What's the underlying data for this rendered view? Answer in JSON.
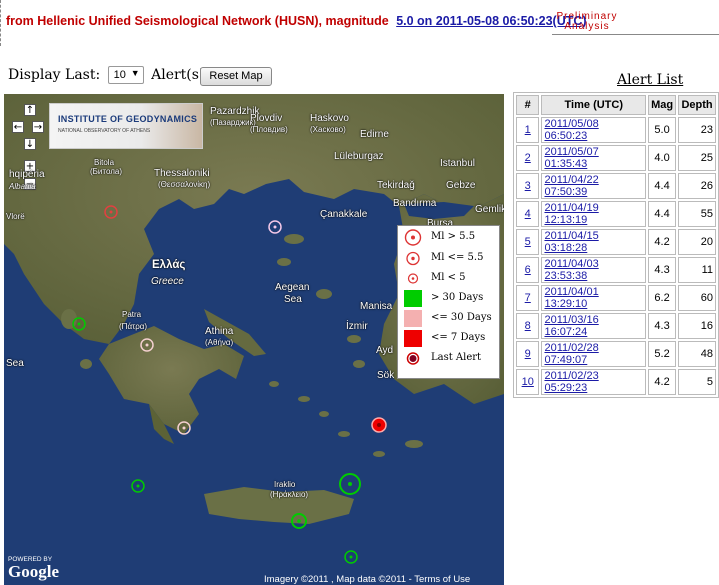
{
  "header": {
    "prefix": "from Hellenic Unified Seismological Network (HUSN), magnitude",
    "link": "5.0 on 2011-05-08 06:50:23(UTC)",
    "prelim_line1": "Preliminary",
    "prelim_line2": "Analysis"
  },
  "controls": {
    "display_last_label": "Display Last:",
    "select_value": "10",
    "alerts_label": "Alert(s)",
    "reset_label": "Reset Map"
  },
  "map": {
    "logo_title": "INSTITUTE OF GEODYNAMICS",
    "logo_sub": "NATIONAL OBSERVATORY OF ATHENS",
    "labels": {
      "shqiperia": "hqipëria",
      "albania": "Albania",
      "bitola": "Bitola",
      "bitola_cyr": "(Битола)",
      "thessaloniki": "Thessaloniki",
      "thessaloniki_gr": "(Θεσσαλονίκη)",
      "vlore": "Vlorë",
      "ellas": "Ελλάς",
      "greece": "Greece",
      "patra": "Patra",
      "patra_gr": "(Πάτρα)",
      "athina": "Athina",
      "athina_gr": "(Αθήνα)",
      "aegean": "Aegean",
      "sea": "Sea",
      "sea_west": "Sea",
      "pazardzhik": "Pazardzhik",
      "pazardzhik_cyr": "(Пазарджик)",
      "plovdiv": "Plovdiv",
      "plovdiv_cyr": "(Пловдив)",
      "haskovo": "Haskovo",
      "haskovo_cyr": "(Хасково)",
      "edirne": "Edirne",
      "luleburgaz": "Lüleburgaz",
      "istanbul": "Istanbul",
      "tekirdag": "Tekirdağ",
      "gebze": "Gebze",
      "bandirma": "Bandırma",
      "gemlik": "Gemlik",
      "canakkale": "Çanakkale",
      "bursa": "Bursa",
      "manisa": "Manisa",
      "izmir": "İzmir",
      "ayd": "Ayd",
      "sok": "Sök",
      "iraklio": "Iraklio",
      "iraklio_gr": "(Ηράκλειο)"
    },
    "powered_by": "POWERED BY",
    "google": "Google",
    "copyright": "Imagery ©2011 , Map data ©2011 - Terms of Use"
  },
  "legend": {
    "items": [
      {
        "label": "Ml > 5.5"
      },
      {
        "label": "Ml <= 5.5"
      },
      {
        "label": "Ml < 5"
      },
      {
        "label": "> 30 Days",
        "color": "#00cc00"
      },
      {
        "label": "<= 30 Days",
        "color": "#f4b0b0"
      },
      {
        "label": "<= 7 Days",
        "color": "#ee0000"
      },
      {
        "label": "Last Alert"
      }
    ]
  },
  "alert_list": {
    "title": "Alert List",
    "columns": [
      "#",
      "Time (UTC)",
      "Mag",
      "Depth"
    ],
    "rows": [
      {
        "n": "1",
        "time": "2011/05/08 06:50:23",
        "mag": "5.0",
        "depth": "23"
      },
      {
        "n": "2",
        "time": "2011/05/07 01:35:43",
        "mag": "4.0",
        "depth": "25"
      },
      {
        "n": "3",
        "time": "2011/04/22 07:50:39",
        "mag": "4.4",
        "depth": "26"
      },
      {
        "n": "4",
        "time": "2011/04/19 12:13:19",
        "mag": "4.4",
        "depth": "55"
      },
      {
        "n": "5",
        "time": "2011/04/15 03:18:28",
        "mag": "4.2",
        "depth": "20"
      },
      {
        "n": "6",
        "time": "2011/04/03 23:53:38",
        "mag": "4.3",
        "depth": "11"
      },
      {
        "n": "7",
        "time": "2011/04/01 13:29:10",
        "mag": "6.2",
        "depth": "60"
      },
      {
        "n": "8",
        "time": "2011/03/16 16:07:24",
        "mag": "4.3",
        "depth": "16"
      },
      {
        "n": "9",
        "time": "2011/02/28 07:49:07",
        "mag": "5.2",
        "depth": "48"
      },
      {
        "n": "10",
        "time": "2011/02/23 05:29:23",
        "mag": "4.2",
        "depth": "5"
      }
    ]
  },
  "colors": {
    "header_red": "#c00000",
    "link_blue": "#1a1aa6",
    "sea": "#1f3d75",
    "land": "#6a7046",
    "old_event": "#00cc00",
    "month_event": "#f4b0b0",
    "week_event": "#ee0000"
  }
}
